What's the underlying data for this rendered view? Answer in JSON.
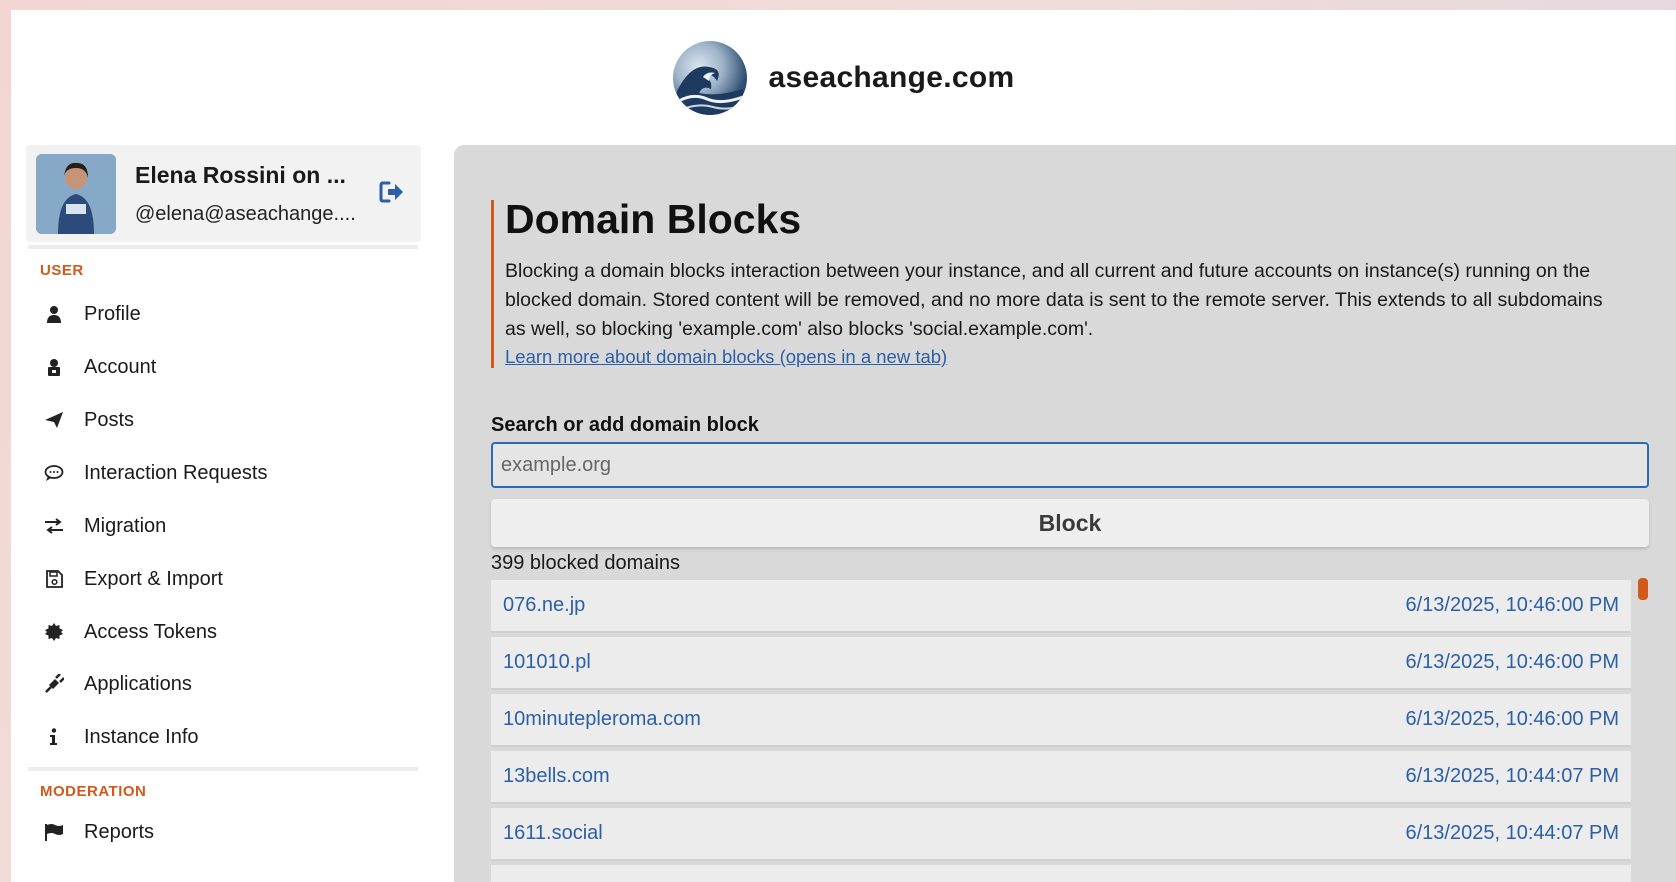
{
  "site": {
    "title": "aseachange.com",
    "logo_icon": "great-wave-logo-icon"
  },
  "user": {
    "name": "Elena Rossini on ...",
    "handle": "@elena@aseachange....",
    "logout_icon": "logout-icon"
  },
  "sidebar": {
    "user_section": "USER",
    "items": [
      {
        "label": "Profile",
        "icon": "person-icon"
      },
      {
        "label": "Account",
        "icon": "user-lock-icon"
      },
      {
        "label": "Posts",
        "icon": "paper-plane-icon"
      },
      {
        "label": "Interaction Requests",
        "icon": "speech-bubble-icon"
      },
      {
        "label": "Migration",
        "icon": "exchange-arrows-icon"
      },
      {
        "label": "Export & Import",
        "icon": "floppy-disk-icon"
      },
      {
        "label": "Access Tokens",
        "icon": "certificate-icon"
      },
      {
        "label": "Applications",
        "icon": "plug-icon"
      },
      {
        "label": "Instance Info",
        "icon": "info-icon"
      }
    ],
    "moderation_section": "MODERATION",
    "moderation_items": [
      {
        "label": "Reports",
        "icon": "flag-icon"
      }
    ]
  },
  "main": {
    "title": "Domain Blocks",
    "description": "Blocking a domain blocks interaction between your instance, and all current and future accounts on instance(s) running on the blocked domain. Stored content will be removed, and no more data is sent to the remote server. This extends to all subdomains as well, so blocking 'example.com' also blocks 'social.example.com'.",
    "learn_more": "Learn more about domain blocks (opens in a new tab)",
    "search_label": "Search or add domain block",
    "search_placeholder": "example.org",
    "block_button": "Block",
    "count_text": "399 blocked domains",
    "rows": [
      {
        "domain": "076.ne.jp",
        "date": "6/13/2025, 10:46:00 PM"
      },
      {
        "domain": "101010.pl",
        "date": "6/13/2025, 10:46:00 PM"
      },
      {
        "domain": "10minutepleroma.com",
        "date": "6/13/2025, 10:46:00 PM"
      },
      {
        "domain": "13bells.com",
        "date": "6/13/2025, 10:44:07 PM"
      },
      {
        "domain": "1611.social",
        "date": "6/13/2025, 10:44:07 PM"
      }
    ]
  },
  "colors": {
    "accent": "#d2591a",
    "link": "#2b5fa8",
    "input_border": "#2b6cb0"
  }
}
